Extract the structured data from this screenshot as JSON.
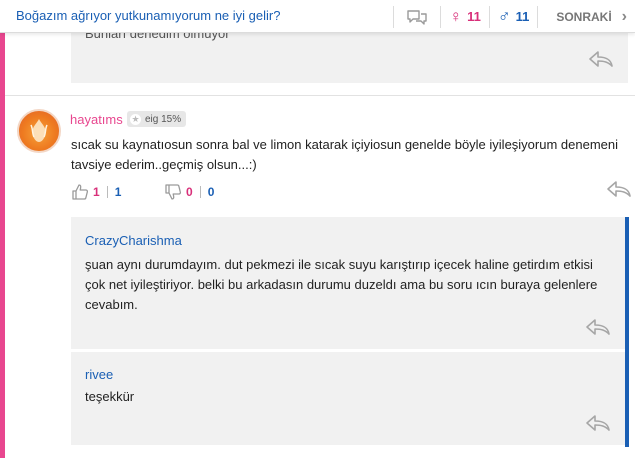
{
  "topbar": {
    "title": "Boğazım ağrıyor yutkunamıyorum ne iyi gelir?",
    "female_count": "11",
    "male_count": "11",
    "next_label": "SONRAKİ",
    "icons": {
      "chat": "chat-bubbles-icon",
      "female": "female-symbol-icon",
      "male": "male-symbol-icon",
      "next": "chevron-right-icon"
    }
  },
  "top_reply": {
    "text": "Bunları denedim olmuyor"
  },
  "comment": {
    "username": "hayatıms",
    "level": "eig 15%",
    "text": "sıcak su kaynatıosun sonra bal ve limon katarak içiyiosun genelde böyle iyileşiyorum denemeni tavsiye ederim..geçmiş olsun...:)",
    "likes_female": "1",
    "likes_male": "1",
    "dislikes_female": "0",
    "dislikes_male": "0"
  },
  "replies": [
    {
      "username": "CrazyCharishma",
      "text": "şuan aynı durumdayım. dut pekmezi ile sıcak suyu karıştırıp içecek haline getirdım etkisi çok net iyileştiriyor. belki bu arkadasın durumu duzeldı ama bu soru ıcın buraya gelenlere cevabım."
    },
    {
      "username": "rivee",
      "text": "teşekkür"
    }
  ],
  "colors": {
    "pink": "#e8478f",
    "blue": "#1a5fb4",
    "reply_bg": "#f1f1f1"
  }
}
